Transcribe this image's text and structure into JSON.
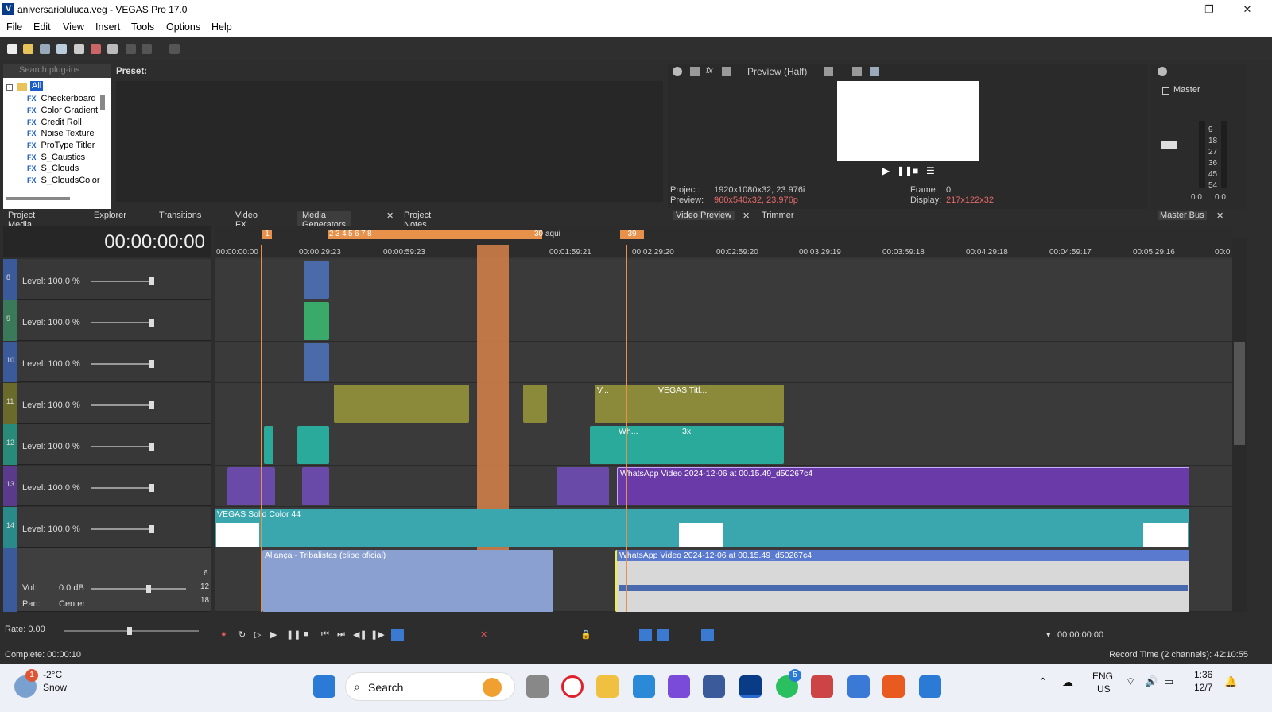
{
  "title_bar": {
    "app_title": "aniversarioluluca.veg - VEGAS Pro 17.0",
    "logo_letter": "V"
  },
  "menu": {
    "items": [
      "File",
      "Edit",
      "View",
      "Insert",
      "Tools",
      "Options",
      "Help"
    ]
  },
  "plugins": {
    "search_placeholder": "Search plug-ins",
    "root": "All",
    "items": [
      "Checkerboard",
      "Color Gradient",
      "Credit Roll",
      "Noise Texture",
      "ProType Titler",
      "S_Caustics",
      "S_Clouds",
      "S_CloudsColor"
    ],
    "fx_badge": "FX",
    "preset_label": "Preset:"
  },
  "tabs_left": [
    "Project Media",
    "Explorer",
    "Transitions",
    "Video FX",
    "Media Generators",
    "Project Notes"
  ],
  "preview": {
    "mode": "Preview (Half)",
    "project_label": "Project:",
    "project_value": "1920x1080x32, 23.976i",
    "preview_label": "Preview:",
    "preview_value": "960x540x32, 23.976p",
    "frame_label": "Frame:",
    "frame_value": "0",
    "display_label": "Display:",
    "display_value": "217x122x32",
    "tabs": [
      "Video Preview",
      "Trimmer"
    ]
  },
  "master": {
    "label": "Master",
    "tab": "Master Bus",
    "scale": [
      "9",
      "18",
      "27",
      "36",
      "45",
      "54"
    ],
    "left": "0.0",
    "right": "0.0"
  },
  "timeline": {
    "timecode": "00:00:00:00",
    "ruler": [
      "00:00:00:00",
      "00:00:29:23",
      "00:00:59:23",
      "00:01:59:21",
      "00:02:29:20",
      "00:02:59:20",
      "00:03:29:19",
      "00:03:59:18",
      "00:04:29:18",
      "00:04:59:17",
      "00:05:29:16",
      "00:0"
    ],
    "markers": [
      "1",
      "2",
      "3",
      "4",
      "5",
      "6",
      "7",
      "8",
      "30",
      "aqui",
      "39"
    ],
    "tracks": [
      {
        "num": "8",
        "level": "Level: 100.0 %"
      },
      {
        "num": "9",
        "level": "Level: 100.0 %"
      },
      {
        "num": "10",
        "level": "Level: 100.0 %"
      },
      {
        "num": "11",
        "level": "Level: 100.0 %"
      },
      {
        "num": "12",
        "level": "Level: 100.0 %"
      },
      {
        "num": "13",
        "level": "Level: 100.0 %"
      },
      {
        "num": "14",
        "level": "Level: 100.0 %"
      }
    ],
    "audio": {
      "vol_label": "Vol:",
      "vol_value": "0.0 dB",
      "pan_label": "Pan:",
      "pan_value": "Center",
      "scale": [
        "6",
        "12",
        "18"
      ]
    },
    "clips": {
      "vegas_titles": "VEGAS Titl...",
      "v_short": "V...",
      "wh_short": "Wh...",
      "three_x": "3x",
      "whatsapp": "WhatsApp Video 2024-12-06 at 00.15.49_d50267c4",
      "solid": "VEGAS Solid Color 44",
      "alianca": "Aliança - Tribalistas (clipe oficial)",
      "whatsapp_audio": "WhatsApp Video 2024-12-06 at 00.15.49_d50267c4"
    },
    "rate": "Rate: 0.00",
    "transport_time": "00:00:00:00"
  },
  "status": {
    "left": "Complete: 00:00:10",
    "right": "Record Time (2 channels): 42:10:55"
  },
  "taskbar": {
    "temp": "-2°C",
    "weather": "Snow",
    "search": "Search",
    "lang": "ENG",
    "region": "US",
    "time": "1:36",
    "date": "12/7",
    "weather_badge": "1",
    "whatsapp_badge": "5"
  }
}
